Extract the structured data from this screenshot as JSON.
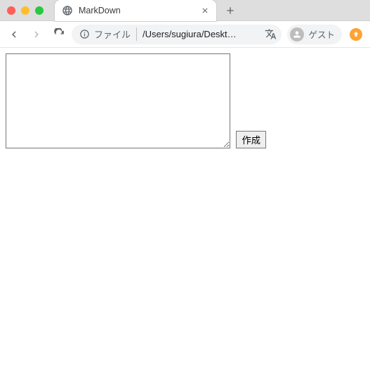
{
  "window": {
    "tab": {
      "title": "MarkDown"
    },
    "new_tab_tooltip": "+"
  },
  "toolbar": {
    "omnibox": {
      "scheme_label": "ファイル",
      "path": "/Users/sugiura/Deskt…"
    },
    "guest_label": "ゲスト"
  },
  "page": {
    "textarea_value": "",
    "create_button_label": "作成"
  }
}
